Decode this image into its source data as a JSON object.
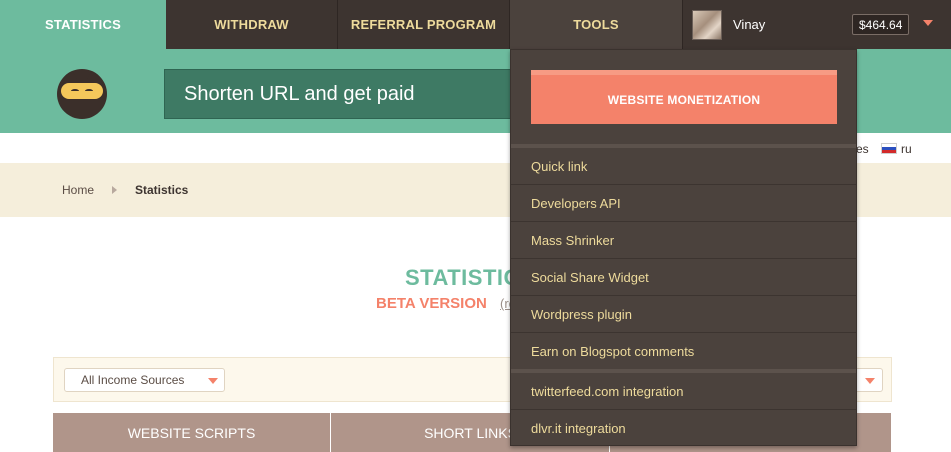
{
  "topnav": {
    "tabs": [
      {
        "label": "STATISTICS"
      },
      {
        "label": "WITHDRAW"
      },
      {
        "label": "REFERRAL PROGRAM"
      },
      {
        "label": "TOOLS"
      }
    ],
    "user": {
      "name": "Vinay",
      "balance": "$464.64"
    }
  },
  "header": {
    "slogan": "Shorten URL and get paid"
  },
  "languages": {
    "es": "es",
    "ru": "ru"
  },
  "breadcrumb": {
    "home": "Home",
    "current": "Statistics"
  },
  "main": {
    "title": "STATISTIC",
    "beta": "BETA VERSION",
    "beta_extra": "(re",
    "income_select": "All Income Sources",
    "stats_tabs": [
      "WEBSITE SCRIPTS",
      "SHORT LINKS",
      ""
    ]
  },
  "tools_menu": {
    "primary": "WEBSITE MONETIZATION",
    "items": [
      "Quick link",
      "Developers API",
      "Mass Shrinker",
      "Social Share Widget",
      "Wordpress plugin",
      "Earn on Blogspot comments",
      "twitterfeed.com integration",
      "dlvr.it integration"
    ]
  },
  "colors": {
    "nav_bg": "#3d3430",
    "accent_green": "#6dbb9e",
    "accent_coral": "#f4826a",
    "menu_text": "#eedb9c"
  },
  "icons": [
    "avatar",
    "caret-down-icon",
    "flag-ru-icon",
    "chevron-right-icon",
    "ninja-logo"
  ]
}
